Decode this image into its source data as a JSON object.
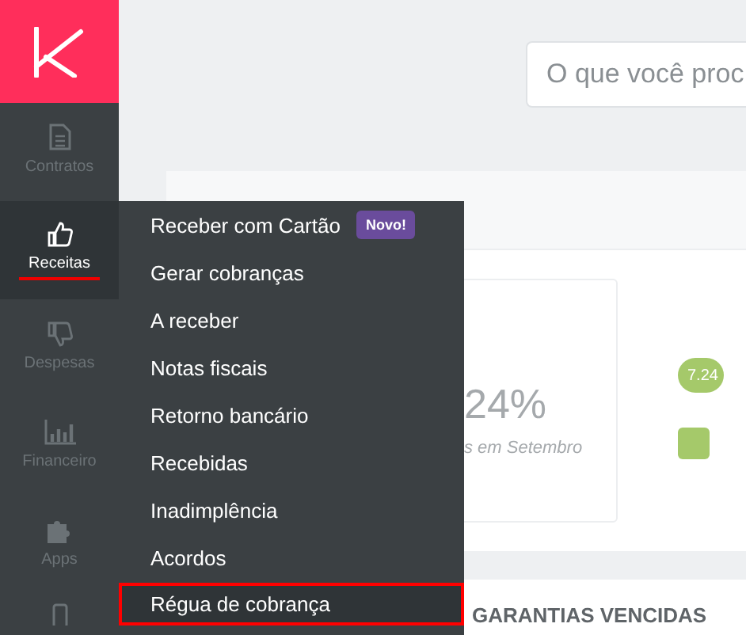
{
  "sidebar": {
    "items": [
      {
        "label": "Contratos",
        "selected": false
      },
      {
        "label": "Receitas",
        "selected": true
      },
      {
        "label": "Despesas",
        "selected": false
      },
      {
        "label": "Financeiro",
        "selected": false
      },
      {
        "label": "Apps",
        "selected": false
      }
    ]
  },
  "submenu": {
    "items": [
      {
        "label": "Receber com Cartão",
        "badge": "Novo!",
        "selected": false
      },
      {
        "label": "Gerar cobranças",
        "selected": false
      },
      {
        "label": "A receber",
        "selected": false
      },
      {
        "label": "Notas fiscais",
        "selected": false
      },
      {
        "label": "Retorno bancário",
        "selected": false
      },
      {
        "label": "Recebidas",
        "selected": false
      },
      {
        "label": "Inadimplência",
        "selected": false
      },
      {
        "label": "Acordos",
        "selected": false
      },
      {
        "label": "Régua de cobrança",
        "selected": true
      }
    ]
  },
  "search": {
    "placeholder": "O que você proc"
  },
  "stat": {
    "value": "24%",
    "caption": "s em Setembro",
    "pill": "7.24"
  },
  "section_title": "GARANTIAS VENCIDAS"
}
